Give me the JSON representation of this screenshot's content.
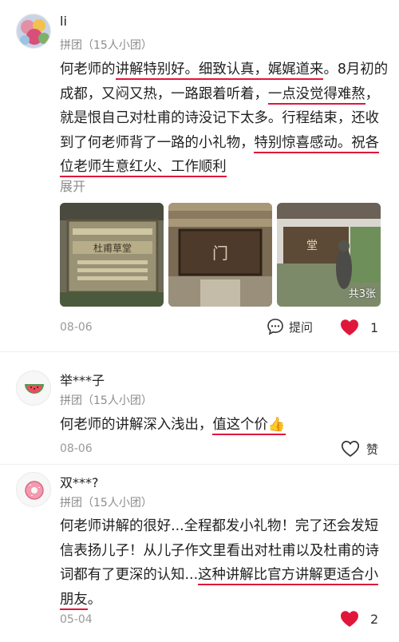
{
  "colors": {
    "accent": "#e0163b",
    "heart": "#e0163b"
  },
  "reviews": [
    {
      "user": "li",
      "group": "拼团（15人小团）",
      "text_segments": [
        "何老师的",
        "讲解特别好。细致认真，娓娓道来",
        "。8月初的成都，又闷又热，一路跟着听着，",
        "一点没觉得难熬",
        "，就是恨自己对杜甫的诗没记下太多。行程结束，还收到了何老师背了一路的小礼物，",
        "特别惊喜感动。祝各位老师生意红火、工作顺利"
      ],
      "expand": "展开",
      "photo_count": "共3张",
      "photo_texts": [
        "杜甫草堂",
        "门",
        "堂"
      ],
      "date": "08-06",
      "ask_label": "提问",
      "likes": "1",
      "liked": true
    },
    {
      "user": "举***子",
      "group": "拼团（15人小团）",
      "text_segments": [
        "何老师的讲解深入浅出，",
        "值这个价",
        "👍"
      ],
      "date": "08-06",
      "like_label": "赞",
      "liked": false
    },
    {
      "user": "双***?",
      "group": "拼团（15人小团）",
      "text_segments": [
        "何老师讲解的很好...全程都发小礼物！完了还会发短信表扬儿子！从儿子作文里看出对杜甫以及杜甫的诗词都有了更深的认知...",
        "这种讲解比官方讲解更适合小朋友",
        "。"
      ],
      "date": "05-04",
      "likes": "2",
      "liked": true
    }
  ]
}
